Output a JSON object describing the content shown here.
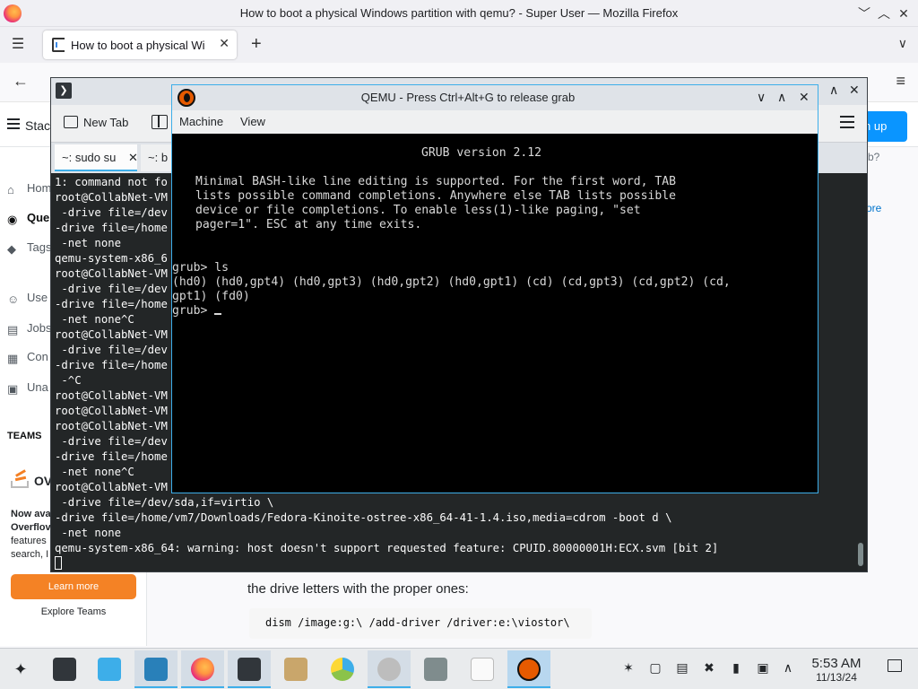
{
  "firefox": {
    "window_title": "How to boot a physical Windows partition with qemu? - Super User — Mozilla Firefox",
    "tab_label": "How to boot a physical Wi",
    "tab_close": "✕",
    "new_tab": "+",
    "min": "﹀",
    "max": "︿",
    "close": "✕"
  },
  "superuser": {
    "logo_text": "Stack",
    "signup": "n up",
    "nav": [
      {
        "label": "Hom",
        "icon": "home-icon"
      },
      {
        "label": "Que",
        "icon": "questions-icon"
      },
      {
        "label": "Tags",
        "icon": "tags-icon"
      },
      {
        "label": "Use",
        "icon": "users-icon"
      },
      {
        "label": "Jobs",
        "icon": "jobs-icon"
      },
      {
        "label": "Con",
        "icon": "companies-icon"
      },
      {
        "label": "Una",
        "icon": "unanswered-icon"
      }
    ],
    "teams_heading": "TEAMS",
    "promo_brand": "OV",
    "promo_lines": [
      "Now ava",
      "Overflov",
      "features",
      "search, I"
    ],
    "learn_more": "Learn more",
    "explore_teams": "Explore Teams",
    "body_text": "the drive letters with the proper ones:",
    "code": "dism /image:g:\\ /add-driver /driver:e:\\viostor\\",
    "right_fragments": [
      "b?",
      "ore",
      "d"
    ]
  },
  "konsole": {
    "new_tab": "New Tab",
    "tabs": [
      "~: sudo su",
      "~: b"
    ],
    "tab_close": "✕",
    "lines": [
      "1: command not fo",
      "root@CollabNet-VM",
      " -drive file=/dev",
      "-drive file=/home",
      " -net none",
      "qemu-system-x86_6",
      "root@CollabNet-VM",
      " -drive file=/dev",
      "-drive file=/home",
      " -net none^C",
      "root@CollabNet-VM",
      " -drive file=/dev",
      "-drive file=/home",
      " -^C",
      "root@CollabNet-VM",
      "root@CollabNet-VM",
      "root@CollabNet-VM",
      " -drive file=/dev",
      "-drive file=/home",
      " -net none^C",
      "root@CollabNet-VM",
      " -drive file=/dev/sda,if=virtio \\",
      "-drive file=/home/vm7/Downloads/Fedora-Kinoite-ostree-x86_64-41-1.4.iso,media=cdrom -boot d \\",
      " -net none",
      "qemu-system-x86_64: warning: host doesn't support requested feature: CPUID.80000001H:ECX.svm [bit 2]"
    ]
  },
  "qemu": {
    "title": "QEMU - Press Ctrl+Alt+G to release grab",
    "menus": [
      "Machine",
      "View"
    ],
    "grub_header": "GRUB version 2.12",
    "grub_help": [
      "Minimal BASH-like line editing is supported. For the first word, TAB",
      "lists possible command completions. Anywhere else TAB lists possible",
      "device or file completions. To enable less(1)-like paging, \"set",
      "pager=1\". ESC at any time exits."
    ],
    "prompt_cmd": "grub> ls",
    "ls_output": [
      "(hd0) (hd0,gpt4) (hd0,gpt3) (hd0,gpt2) (hd0,gpt1) (cd) (cd,gpt3) (cd,gpt2) (cd,",
      "gpt1) (fd0)"
    ],
    "prompt": "grub> "
  },
  "taskbar": {
    "time": "5:53 AM",
    "date": "11/13/24"
  },
  "colors": {
    "accent": "#3daee9",
    "terminal_bg": "#232627",
    "learn_more_bg": "#f48225",
    "signup_bg": "#0a95ff"
  }
}
